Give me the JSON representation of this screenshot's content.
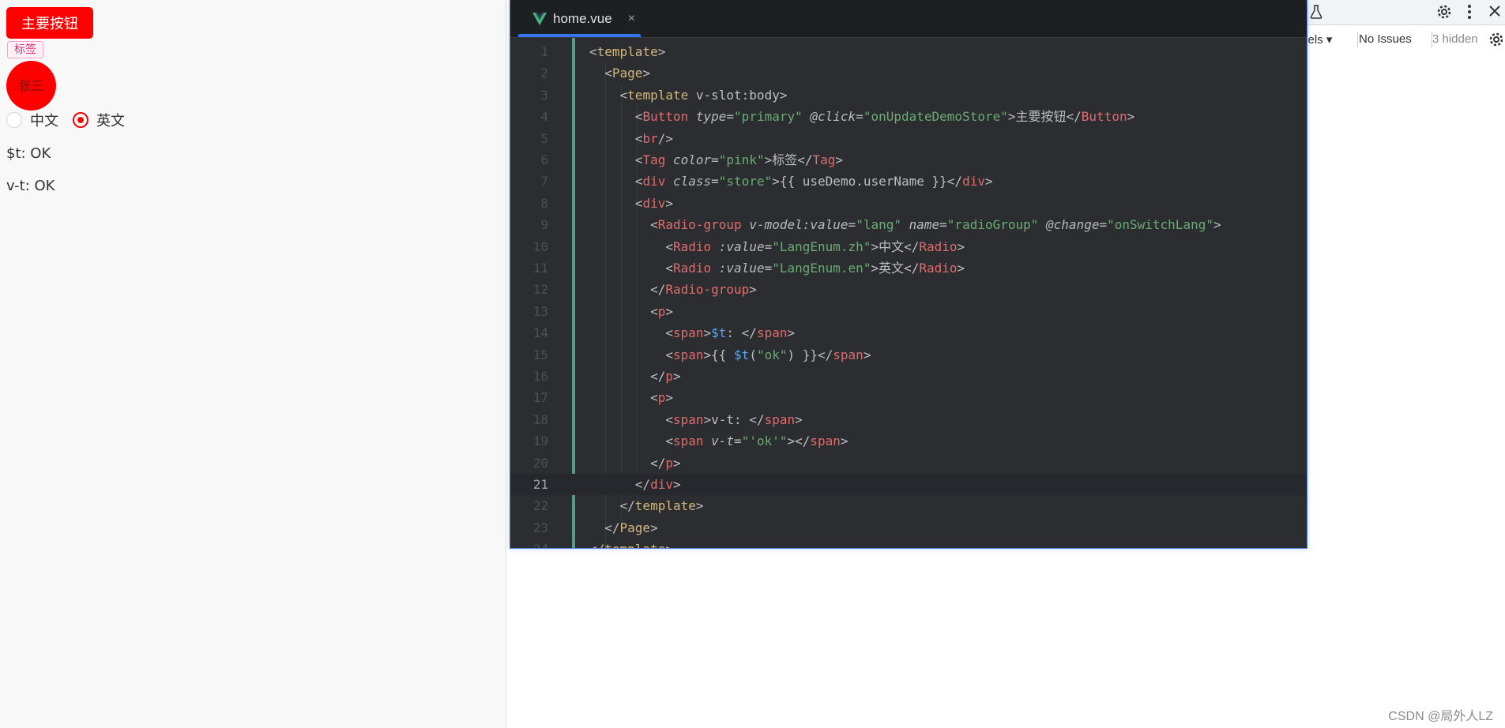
{
  "preview": {
    "primary_button": "主要按钮",
    "tag": "标签",
    "avatar": "张三",
    "radio_zh": "中文",
    "radio_en": "英文",
    "radio_selected": "英文",
    "line_t": "$t:  OK",
    "line_vt": "v-t:  OK"
  },
  "devtools": {
    "levels": "vels ▾",
    "issues": "No Issues",
    "hidden": "3 hidden"
  },
  "editor": {
    "tab_name": "home.vue",
    "tab_close": "×",
    "current_line": 21,
    "lines": [
      {
        "n": "1",
        "text": "<template>"
      },
      {
        "n": "2",
        "text": "  <Page>"
      },
      {
        "n": "3",
        "text": "    <template v-slot:body>"
      },
      {
        "n": "4",
        "text": "      <Button type=\"primary\" @click=\"onUpdateDemoStore\">主要按钮</Button>"
      },
      {
        "n": "5",
        "text": "      <br/>"
      },
      {
        "n": "6",
        "text": "      <Tag color=\"pink\">标签</Tag>"
      },
      {
        "n": "7",
        "text": "      <div class=\"store\">{{ useDemo.userName }}</div>"
      },
      {
        "n": "8",
        "text": "      <div>"
      },
      {
        "n": "9",
        "text": "        <Radio-group v-model:value=\"lang\" name=\"radioGroup\" @change=\"onSwitchLang\">"
      },
      {
        "n": "10",
        "text": "          <Radio :value=\"LangEnum.zh\">中文</Radio>"
      },
      {
        "n": "11",
        "text": "          <Radio :value=\"LangEnum.en\">英文</Radio>"
      },
      {
        "n": "12",
        "text": "        </Radio-group>"
      },
      {
        "n": "13",
        "text": "        <p>"
      },
      {
        "n": "14",
        "text": "          <span>$t: </span>"
      },
      {
        "n": "15",
        "text": "          <span>{{ $t(\"ok\") }}</span>"
      },
      {
        "n": "16",
        "text": "        </p>"
      },
      {
        "n": "17",
        "text": "        <p>"
      },
      {
        "n": "18",
        "text": "          <span>v-t: </span>"
      },
      {
        "n": "19",
        "text": "          <span v-t=\"'ok'\"></span>"
      },
      {
        "n": "20",
        "text": "        </p>"
      },
      {
        "n": "21",
        "text": "      </div>"
      },
      {
        "n": "22",
        "text": "    </template>"
      },
      {
        "n": "23",
        "text": "  </Page>"
      },
      {
        "n": "24",
        "text": "</template>"
      }
    ]
  },
  "watermark": "CSDN @局外人LZ"
}
